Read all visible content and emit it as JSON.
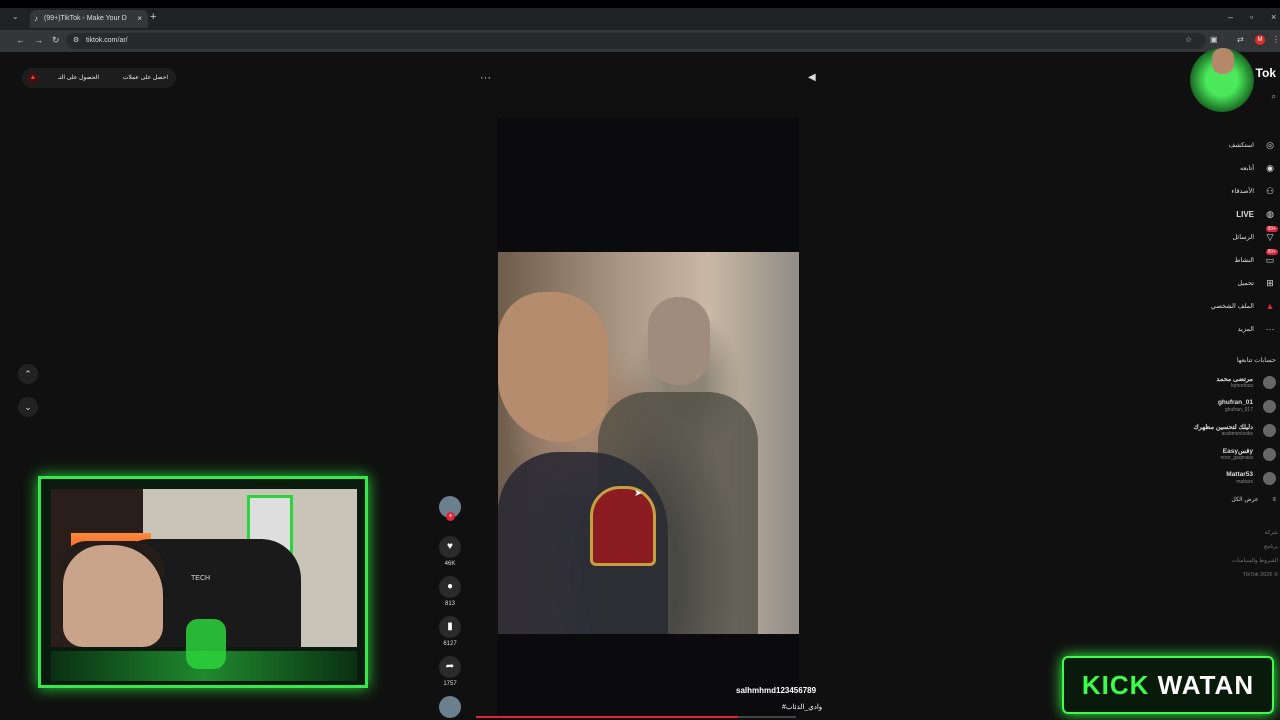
{
  "browser": {
    "tab_title": "(99+)TikTok - Make Your D",
    "url": "tiktok.com/ar/",
    "profile_initial": "M"
  },
  "page": {
    "top_buttons": {
      "coins": "احصل على عملات",
      "app": "الحصول على التـ"
    },
    "video": {
      "author": "salhmhmd123456789",
      "hashtag": "#وادي_الذئاب",
      "progress": 0.82
    },
    "actions": {
      "likes": "46K",
      "comments": "813",
      "saves": "6127",
      "shares": "1757"
    }
  },
  "sidebar": {
    "logo": "Tok",
    "nav": [
      {
        "label": "استكشف",
        "icon": "compass-icon"
      },
      {
        "label": "أتابعه",
        "icon": "following-icon"
      },
      {
        "label": "الأصدقاء",
        "icon": "friends-icon"
      },
      {
        "label": "LIVE",
        "icon": "live-icon"
      },
      {
        "label": "الرسائل",
        "icon": "messages-icon",
        "badge": "99+"
      },
      {
        "label": "النشاط",
        "icon": "activity-icon",
        "badge": "99+"
      },
      {
        "label": "تحميل",
        "icon": "upload-icon"
      },
      {
        "label": "الملف الشخصي",
        "icon": "profile-icon"
      },
      {
        "label": "المزيد",
        "icon": "more-icon"
      }
    ],
    "following_title": "حسابات تتابعها",
    "accounts": [
      {
        "name": "مرتضى محمد",
        "handle": "lqmortoza"
      },
      {
        "name": "ghufran_01",
        "handle": "ghufran_017"
      },
      {
        "name": "دليلك لتحسين مظهرك",
        "handle": "arabmenlooks"
      },
      {
        "name": "Easyقسy",
        "handle": "noor_gaqmara"
      },
      {
        "name": "Mattar53",
        "handle": "mattarx"
      }
    ],
    "see_all": "عرض الكل",
    "footer": [
      "شركة",
      "برنامج",
      "الشروط والسياسات",
      "TikTok 2026 ©"
    ]
  },
  "overlay": {
    "cam_chair_brand": "TECH",
    "kick_word": "KICK",
    "watan_word": "WATAN"
  }
}
